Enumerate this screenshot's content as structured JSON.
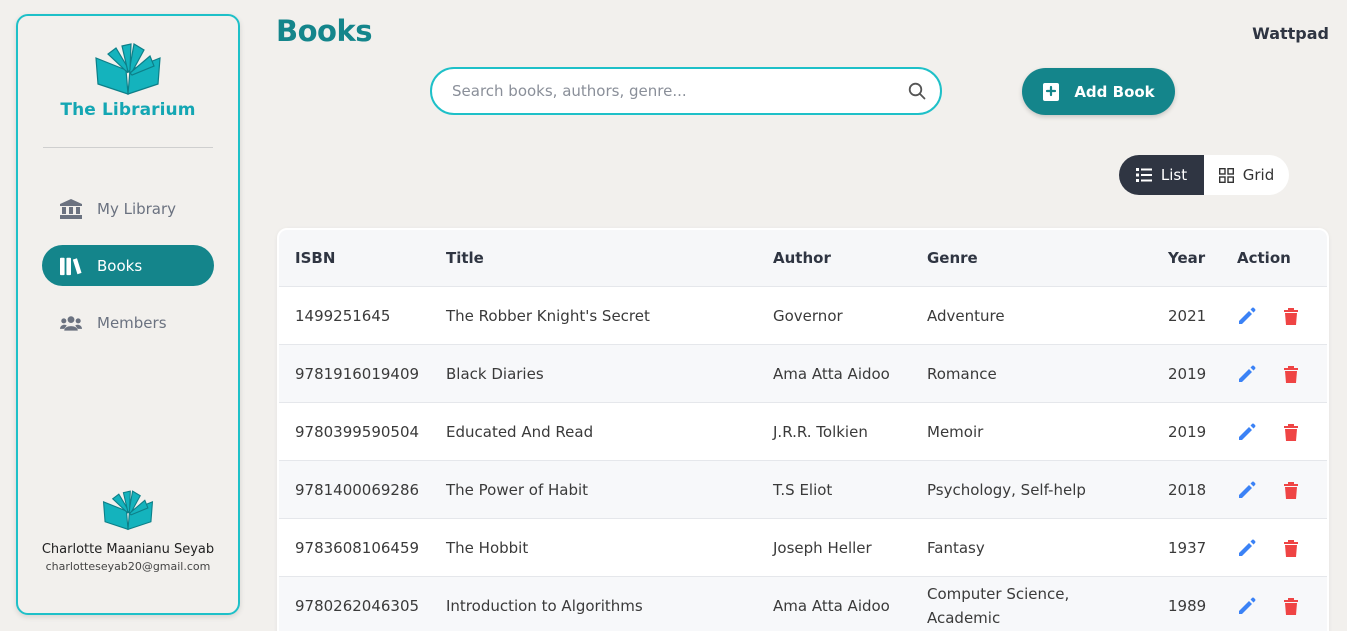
{
  "app": {
    "brand": "The Librarium",
    "page_title": "Books",
    "top_right": "Wattpad"
  },
  "sidebar": {
    "items": [
      {
        "label": "My Library",
        "icon": "bank-icon",
        "active": false
      },
      {
        "label": "Books",
        "icon": "books-icon",
        "active": true
      },
      {
        "label": "Members",
        "icon": "users-icon",
        "active": false
      }
    ],
    "user": {
      "name": "Charlotte Maanianu Seyab",
      "email": "charlotteseyab20@gmail.com"
    }
  },
  "search": {
    "placeholder": "Search books, authors, genre...",
    "value": ""
  },
  "toolbar": {
    "add_label": "Add Book",
    "view_list": "List",
    "view_grid": "Grid",
    "active_view": "List"
  },
  "table": {
    "headers": {
      "isbn": "ISBN",
      "title": "Title",
      "author": "Author",
      "genre": "Genre",
      "year": "Year",
      "action": "Action"
    },
    "rows": [
      {
        "isbn": "1499251645",
        "title": "The Robber Knight's Secret",
        "author": "Governor",
        "genre": "Adventure",
        "year": "2021"
      },
      {
        "isbn": "9781916019409",
        "title": "Black Diaries",
        "author": "Ama Atta Aidoo",
        "genre": "Romance",
        "year": "2019"
      },
      {
        "isbn": "9780399590504",
        "title": "Educated And Read",
        "author": "J.R.R. Tolkien",
        "genre": "Memoir",
        "year": "2019"
      },
      {
        "isbn": "9781400069286",
        "title": "The Power of Habit",
        "author": "T.S Eliot",
        "genre": "Psychology, Self-help",
        "year": "2018"
      },
      {
        "isbn": "9783608106459",
        "title": "The Hobbit",
        "author": "Joseph Heller",
        "genre": "Fantasy",
        "year": "1937"
      },
      {
        "isbn": "9780262046305",
        "title": "Introduction to Algorithms",
        "author": "Ama Atta Aidoo",
        "genre": "Computer Science, Academic",
        "year": "1989"
      }
    ]
  },
  "colors": {
    "accent": "#14858b",
    "accent_light": "#1ec0c8",
    "dark": "#2f3542",
    "edit": "#3b82f6",
    "delete": "#ef4444",
    "background": "#f2f0ed"
  }
}
